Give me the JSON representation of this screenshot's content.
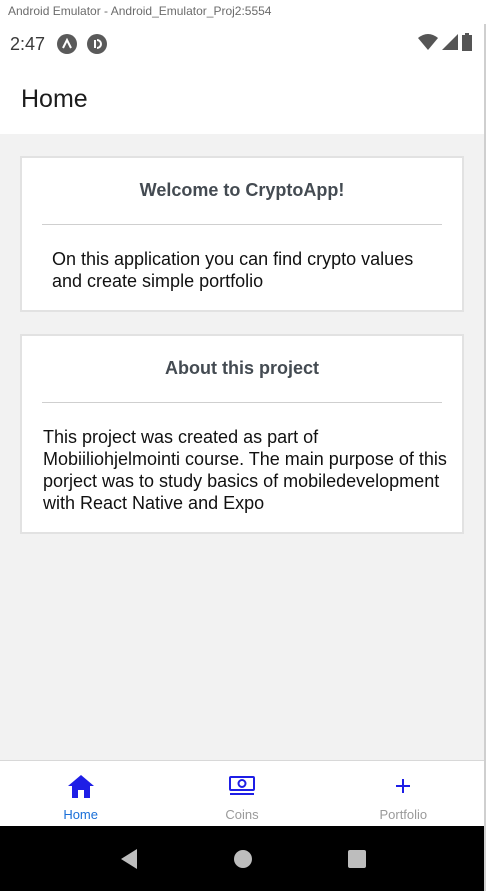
{
  "window": {
    "title": "Android Emulator - Android_Emulator_Proj2:5554"
  },
  "status_bar": {
    "time": "2:47",
    "left_icons": [
      "expo-icon",
      "app-notification-icon"
    ],
    "right_icons": [
      "wifi-icon",
      "cellular-signal-icon",
      "battery-icon"
    ]
  },
  "app_bar": {
    "title": "Home"
  },
  "cards": [
    {
      "title": "Welcome to CryptoApp!",
      "body": "On this application you can find crypto values and create simple portfolio"
    },
    {
      "title": "About this project",
      "body": "This project was created as part of Mobiiliohjelmointi course. The main purpose of this porject was to study basics of mobiledevelopment with React Native and Expo"
    }
  ],
  "tabs": [
    {
      "label": "Home",
      "icon": "home-icon",
      "active": true
    },
    {
      "label": "Coins",
      "icon": "money-icon",
      "active": false
    },
    {
      "label": "Portfolio",
      "icon": "plus-icon",
      "active": false
    }
  ],
  "colors": {
    "accent_tab_icon": "#1e1ee6",
    "active_label": "#1a6fd8",
    "inactive_label": "#9a9a9a",
    "background": "#f2f2f2"
  },
  "nav_buttons": [
    "back-icon",
    "home-circle-icon",
    "overview-icon"
  ]
}
